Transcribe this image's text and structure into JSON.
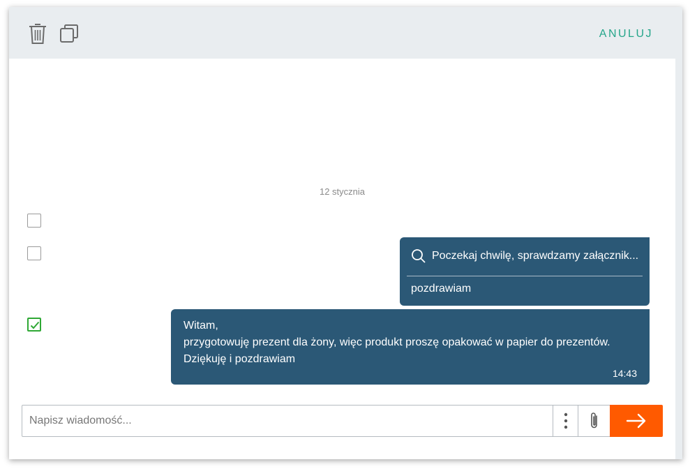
{
  "toolbar": {
    "delete_icon": "trash-icon",
    "copy_icon": "copy-icon",
    "cancel_label": "ANULUJ"
  },
  "conversation": {
    "date": "12 stycznia",
    "messages": [
      {
        "selected": false,
        "scan_icon": "search-icon",
        "scan_text": "Poczekaj chwilę, sprawdzamy załącznik...",
        "text": "pozdrawiam"
      },
      {
        "selected": true,
        "lines": [
          "Witam,",
          "przygotowuję prezent dla żony, więc produkt proszę opakować w papier do prezentów.",
          "Dziękuję i pozdrawiam"
        ],
        "time": "14:43"
      }
    ]
  },
  "composer": {
    "placeholder": "Napisz wiadomość...",
    "more_icon": "more-vertical-icon",
    "attach_icon": "paperclip-icon",
    "send_icon": "arrow-right-icon"
  },
  "colors": {
    "accent": "#25a58a",
    "bubble": "#2b5876",
    "send": "#ff5a00",
    "checked": "#2fa835"
  }
}
